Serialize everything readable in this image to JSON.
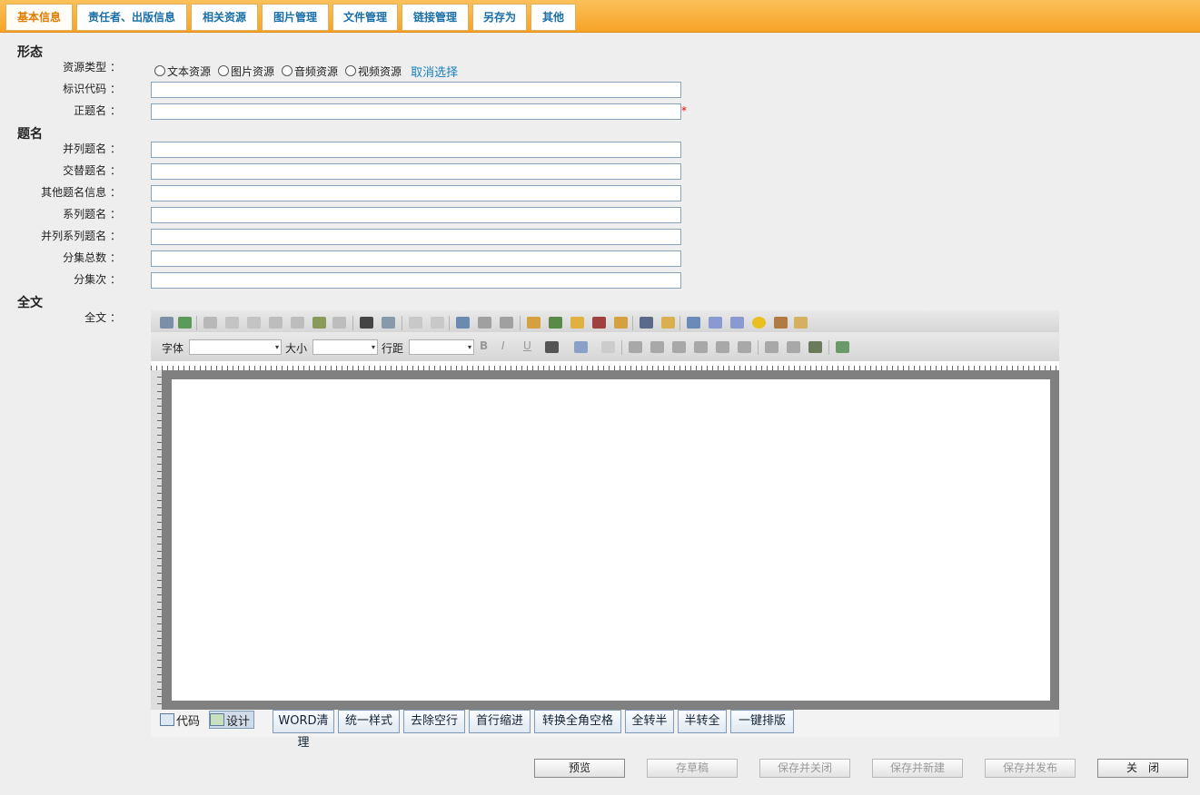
{
  "tabs": [
    "基本信息",
    "责任者、出版信息",
    "相关资源",
    "图片管理",
    "文件管理",
    "链接管理",
    "另存为",
    "其他"
  ],
  "sections": {
    "form": "形态",
    "title": "题名",
    "fulltext": "全文"
  },
  "fields": {
    "resource_type": "资源类型 ：",
    "id_code": "标识代码 ：",
    "main_title": "正题名 ：",
    "parallel_title": "并列题名 ：",
    "alt_title": "交替题名 ：",
    "other_title_info": "其他题名信息 ：",
    "series_title": "系列题名 ：",
    "parallel_series_title": "并列系列题名 ：",
    "total_volumes": "分集总数 ：",
    "volume_no": "分集次 ：",
    "fulltext": "全文 ："
  },
  "required_mark": "*",
  "resource_types": [
    "文本资源",
    "图片资源",
    "音频资源",
    "视频资源"
  ],
  "cancel_selection": "取消选择",
  "editor": {
    "font_label": "字体",
    "size_label": "大小",
    "spacing_label": "行距",
    "mode_code": "代码",
    "mode_design": "设计",
    "actions": [
      "WORD清理",
      "统一样式",
      "去除空行",
      "首行缩进",
      "转换全角空格",
      "全转半",
      "半转全",
      "一键排版"
    ],
    "arrow": "▾",
    "bold": "B",
    "italic": "I",
    "underline": "U"
  },
  "buttons": {
    "preview": "预览",
    "save_draft": "存草稿",
    "save_close": "保存并关闭",
    "save_new": "保存并新建",
    "save_publish": "保存并发布",
    "close": "关　闭"
  },
  "colors": {
    "tab_bar": "#f7a326",
    "tab_text": "#1a6fa8",
    "active_tab_text": "#e07b00",
    "link": "#1a7fc0"
  }
}
